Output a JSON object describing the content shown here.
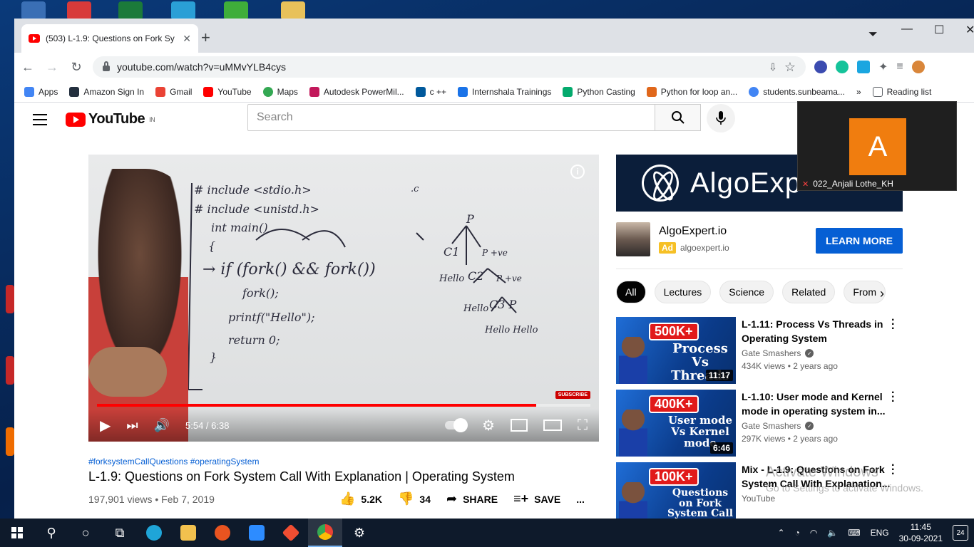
{
  "browser": {
    "tab_title": "(503) L-1.9: Questions on Fork Sy",
    "new_tab": "+",
    "url": "youtube.com/watch?v=uMMvYLB4cys",
    "bookmarks": [
      {
        "label": "Apps",
        "color": "#4285f4"
      },
      {
        "label": "Amazon Sign In",
        "color": "#232f3e"
      },
      {
        "label": "Gmail",
        "color": "#ea4335"
      },
      {
        "label": "YouTube",
        "color": "#ff0000"
      },
      {
        "label": "Maps",
        "color": "#34a853"
      },
      {
        "label": "Autodesk PowerMil...",
        "color": "#c2185b"
      },
      {
        "label": "c ++",
        "color": "#00599c"
      },
      {
        "label": "Internshala Trainings",
        "color": "#1a73e8"
      },
      {
        "label": "Python Casting",
        "color": "#04aa6d"
      },
      {
        "label": "Python for loop an...",
        "color": "#e0671b"
      },
      {
        "label": "students.sunbeama...",
        "color": "#4285f4"
      }
    ],
    "bookmarks_more": "»",
    "reading_list": "Reading list"
  },
  "youtube": {
    "logo_text": "YouTube",
    "region": "IN",
    "search_placeholder": "Search"
  },
  "player": {
    "time": "5:54 / 6:38",
    "progress_fraction": 0.89,
    "subscribe_wm": "SUBSCRIBE",
    "info": "i"
  },
  "video": {
    "hashtags": "#forksystemCallQuestions #operatingSystem",
    "title": "L-1.9: Questions on Fork System Call With Explanation | Operating System",
    "views_date": "197,901 views • Feb 7, 2019",
    "likes": "5.2K",
    "dislikes": "34",
    "share": "SHARE",
    "save": "SAVE",
    "more": "..."
  },
  "ad": {
    "banner_text": "AlgoExp",
    "name": "AlgoExpert.io",
    "badge": "Ad",
    "domain": "algoexpert.io",
    "cta": "LEARN MORE"
  },
  "chips": [
    "All",
    "Lectures",
    "Science",
    "Related",
    "From"
  ],
  "chip_next": "›",
  "recommendations": [
    {
      "title": "L-1.11: Process Vs Threads in Operating System",
      "channel": "Gate Smashers",
      "verified": true,
      "meta": "434K views • 2 years ago",
      "duration": "11:17",
      "badge": "500K+",
      "thumb_text": "Process Vs Threads"
    },
    {
      "title": "L-1.10: User mode and Kernel mode in operating system in...",
      "channel": "Gate Smashers",
      "verified": true,
      "meta": "297K views • 2 years ago",
      "duration": "6:46",
      "badge": "400K+",
      "thumb_text": "User mode Vs Kernel mode"
    },
    {
      "title": "Mix - L-1.9: Questions on Fork System Call With Explanation...",
      "channel": "YouTube",
      "verified": false,
      "meta": "",
      "duration": "",
      "badge": "100K+",
      "thumb_text": "Questions on Fork System Call"
    }
  ],
  "meeting": {
    "initial": "A",
    "name": "022_Anjali Lothe_KH"
  },
  "watermark": {
    "title": "Activate Windows",
    "subtitle": "Go to Settings to activate Windows."
  },
  "taskbar": {
    "lang": "ENG",
    "time": "11:45",
    "date": "30-09-2021",
    "notifications": "24"
  }
}
